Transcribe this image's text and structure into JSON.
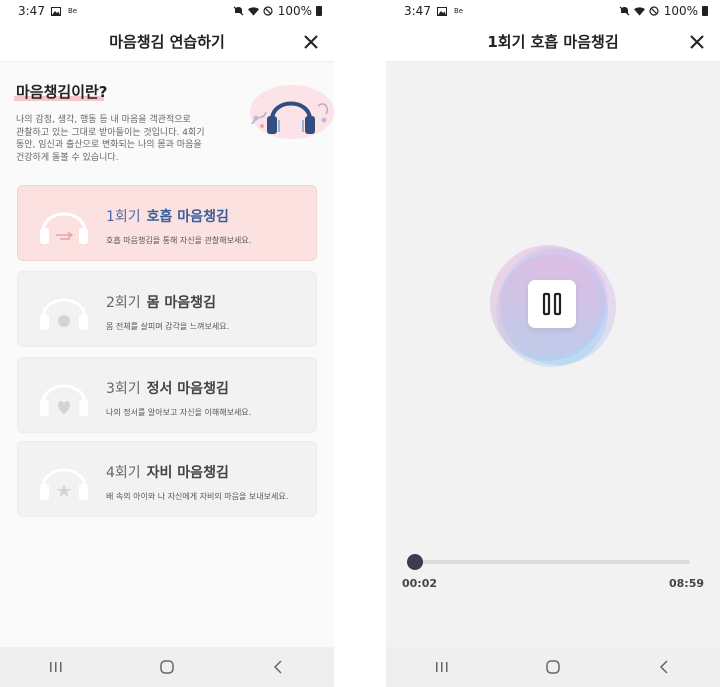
{
  "left_screen": {
    "status_bar": {
      "time": "3:47",
      "badge": "Be",
      "battery": "100%"
    },
    "app_bar": {
      "title": "마음챙김 연습하기",
      "close_icon": "close-icon"
    },
    "intro": {
      "heading": "마음챙김이란?",
      "body_lines": [
        "나의 감정, 생각, 행동 등 내 마음을 객관적으로",
        "관찰하고 있는 그대로 받아들이는 것입니다. 4회기",
        "동안, 임신과 출산으로 변화되는 나의 몸과 마음을",
        "건강하게 돌볼 수 있습니다."
      ]
    },
    "sessions": [
      {
        "number": "1회기",
        "name": "호흡 마음챙김",
        "description": "호흡 마음챙김을 통해 자신을 관찰해보세요.",
        "icon": "breath-headphones-icon",
        "active": true
      },
      {
        "number": "2회기",
        "name": "몸 마음챙김",
        "description": "몸 전체를 살피며 감각을 느껴보세요.",
        "icon": "body-headphones-icon",
        "active": false
      },
      {
        "number": "3회기",
        "name": "정서 마음챙김",
        "description": "나의 정서를 알아보고 자신을 이해해보세요.",
        "icon": "heart-headphones-icon",
        "active": false
      },
      {
        "number": "4회기",
        "name": "자비 마음챙김",
        "description": "배 속의 아이와 나 자신에게 자비의 마음을 보내보세요.",
        "icon": "star-headphones-icon",
        "active": false
      }
    ]
  },
  "right_screen": {
    "status_bar": {
      "time": "3:47",
      "badge": "Be",
      "battery": "100%"
    },
    "app_bar": {
      "title": "1회기 호흡 마음챙김",
      "close_icon": "close-icon"
    },
    "player": {
      "state_icon": "pause-icon",
      "current_time": "00:02",
      "total_time": "08:59",
      "progress": 0.004
    }
  },
  "navigation_bar": {
    "recents_icon": "recents-icon",
    "home_icon": "home-icon",
    "back_icon": "back-icon"
  },
  "colors": {
    "active_card": "#fbe2e1",
    "inactive_card": "#f2f2f2",
    "accent_blue": "#39609c",
    "heading_underline": "#f4c7cf",
    "slider": "#3a3d4e"
  }
}
